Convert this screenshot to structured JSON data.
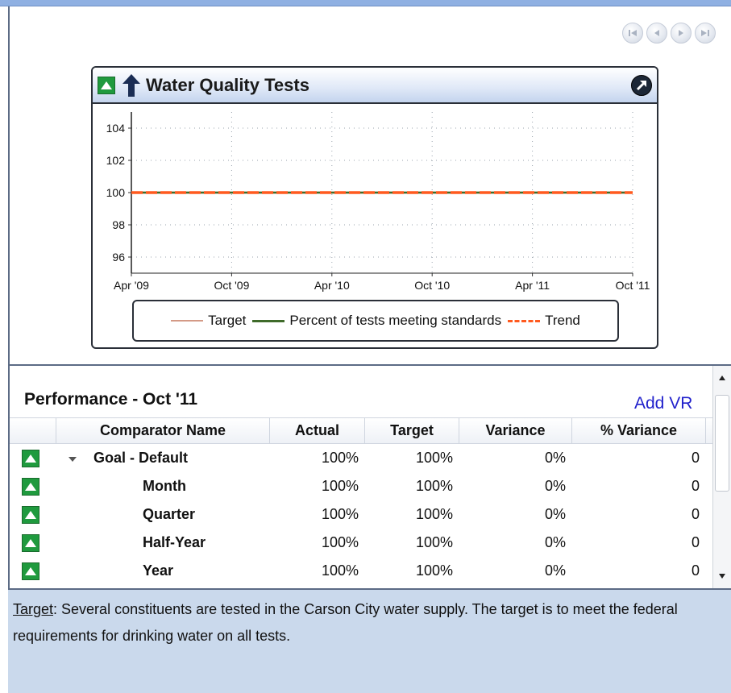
{
  "navigation": {
    "first": "first-page",
    "prev": "previous-page",
    "next": "next-page",
    "last": "last-page"
  },
  "widget": {
    "title": "Water Quality Tests",
    "status_color": "#1f9a3e",
    "trend_icon": "arrow-up-icon",
    "expand_icon": "expand-icon"
  },
  "chart_data": {
    "type": "line",
    "title": "",
    "xlabel": "",
    "ylabel": "",
    "x_ticks": [
      "Apr '09",
      "Oct '09",
      "Apr '10",
      "Oct '10",
      "Apr '11",
      "Oct '11"
    ],
    "y_ticks": [
      "96",
      "98",
      "100",
      "102",
      "104"
    ],
    "ylim": [
      95,
      105
    ],
    "grid": true,
    "series": [
      {
        "name": "Target",
        "color": "#d49a86",
        "style": "solid",
        "values": [
          100,
          100,
          100,
          100,
          100,
          100
        ]
      },
      {
        "name": "Percent of tests meeting standards",
        "color": "#3f6b2a",
        "style": "solid",
        "values": [
          100,
          100,
          100,
          100,
          100,
          100
        ]
      },
      {
        "name": "Trend",
        "color": "#ff5a1f",
        "style": "dashed",
        "values": [
          100,
          100,
          100,
          100,
          100,
          100
        ]
      }
    ]
  },
  "performance": {
    "title": "Performance  -  Oct '11",
    "add_vr": "Add VR",
    "columns": [
      "Comparator Name",
      "Actual",
      "Target",
      "Variance",
      "% Variance"
    ],
    "rows": [
      {
        "name": "Goal - Default",
        "actual": "100%",
        "target": "100%",
        "variance": "0%",
        "pct_variance": "0",
        "expandable": true
      },
      {
        "name": "Month",
        "actual": "100%",
        "target": "100%",
        "variance": "0%",
        "pct_variance": "0",
        "expandable": false
      },
      {
        "name": "Quarter",
        "actual": "100%",
        "target": "100%",
        "variance": "0%",
        "pct_variance": "0",
        "expandable": false
      },
      {
        "name": "Half-Year",
        "actual": "100%",
        "target": "100%",
        "variance": "0%",
        "pct_variance": "0",
        "expandable": false
      },
      {
        "name": "Year",
        "actual": "100%",
        "target": "100%",
        "variance": "0%",
        "pct_variance": "0",
        "expandable": false
      }
    ]
  },
  "description": {
    "label": "Target",
    "text": ":  Several constituents are tested in the Carson City water supply.  The target is to meet the federal requirements for drinking water on all tests."
  }
}
